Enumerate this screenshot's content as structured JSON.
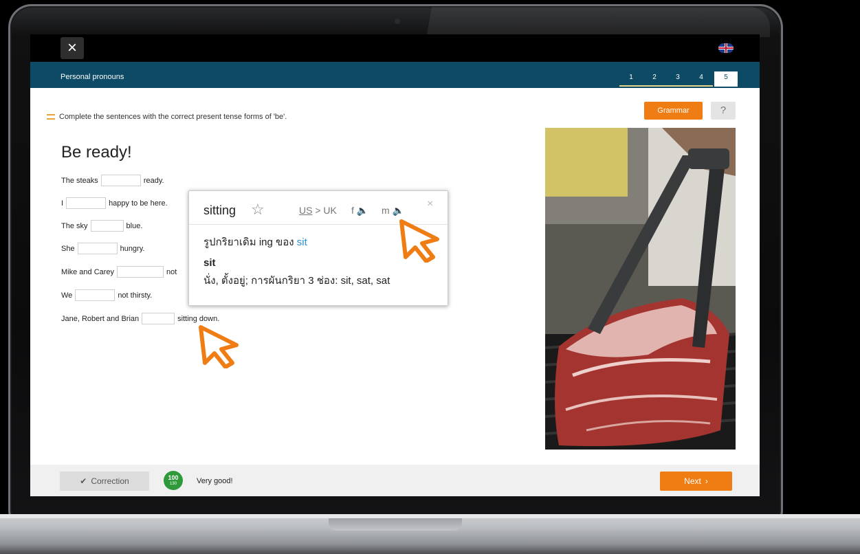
{
  "topbar": {
    "close_icon": "close-icon",
    "language_flag": "uk-flag-icon"
  },
  "lesson": {
    "title": "Personal pronouns",
    "steps": [
      "1",
      "2",
      "3",
      "4",
      "5"
    ],
    "active_step": "5"
  },
  "exercise": {
    "instruction": "Complete the sentences with the correct present tense forms of 'be'.",
    "grammar_label": "Grammar",
    "help_label": "?",
    "heading": "Be ready!",
    "sentences": [
      {
        "before": "The steaks",
        "after": "ready."
      },
      {
        "before": "I",
        "after": "happy to be here."
      },
      {
        "before": "The sky",
        "after": "blue."
      },
      {
        "before": "She",
        "after": "hungry."
      },
      {
        "before": "Mike and Carey",
        "after": "not"
      },
      {
        "before": "We",
        "after": "not thirsty."
      },
      {
        "before": "Jane, Robert and Brian",
        "after": "sitting down."
      }
    ]
  },
  "dictionary_popup": {
    "word": "sitting",
    "star": "☆",
    "dialect": {
      "us": "US",
      "separator": " > ",
      "uk": "UK"
    },
    "female_audio": "f",
    "male_audio": "m",
    "close": "×",
    "form_prefix": "รูปกริยาเดิม ing ของ ",
    "form_link": "sit",
    "base_word": "sit",
    "definition": "นั่ง, ตั้งอยู่; การผันกริยา 3 ช่อง: sit, sat, sat"
  },
  "footer": {
    "correction_label": "Correction",
    "score_top": "100",
    "score_bottom": "130",
    "feedback": "Very good!",
    "next_label": "Next"
  },
  "colors": {
    "accent": "#f07d13",
    "header": "#0d4a66",
    "link": "#2a8fd0",
    "badge": "#2f9a3a"
  }
}
